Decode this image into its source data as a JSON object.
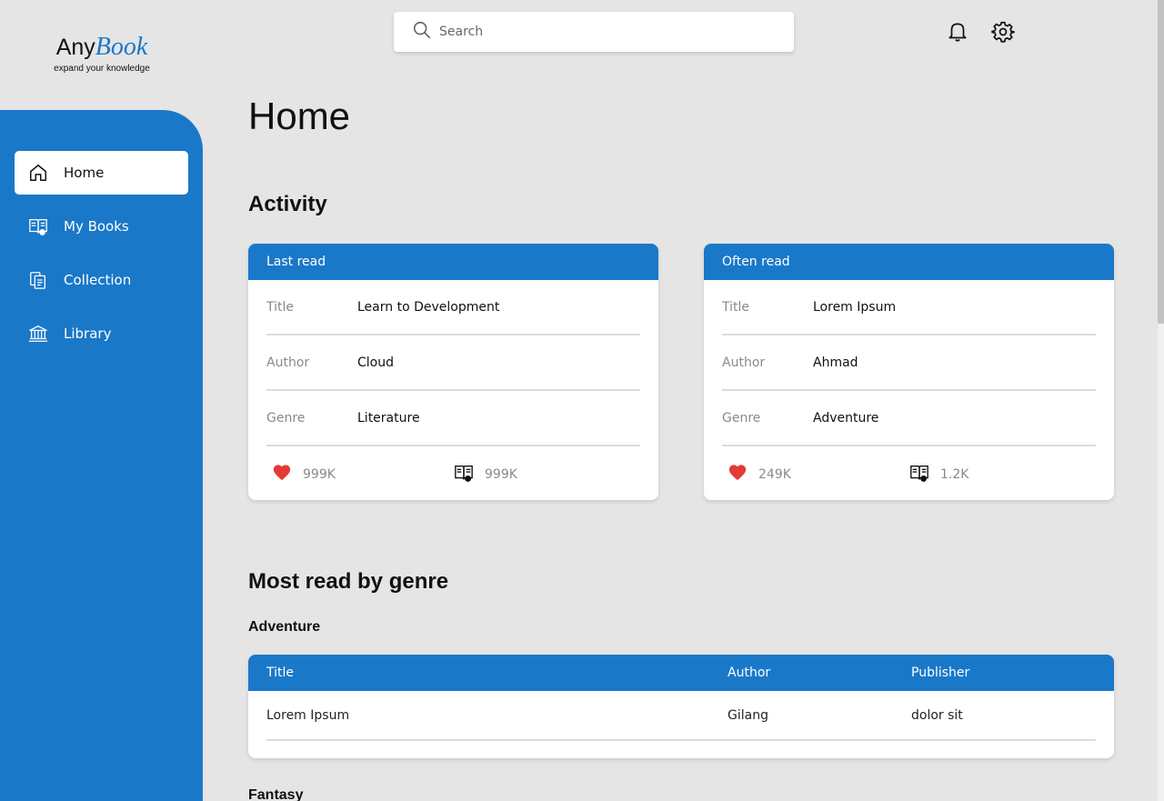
{
  "app": {
    "logo_any": "Any",
    "logo_book": "Book",
    "tagline": "expand your knowledge"
  },
  "colors": {
    "accent": "#1a78c9",
    "background": "#e5e5e5",
    "heart": "#e53935"
  },
  "search": {
    "placeholder": "Search"
  },
  "sidebar": {
    "items": [
      {
        "label": "Home",
        "icon": "home-icon",
        "active": true
      },
      {
        "label": "My Books",
        "icon": "book-reading-icon",
        "active": false
      },
      {
        "label": "Collection",
        "icon": "collection-icon",
        "active": false
      },
      {
        "label": "Library",
        "icon": "library-icon",
        "active": false
      }
    ]
  },
  "header": {
    "title": "Home"
  },
  "activity": {
    "title": "Activity",
    "cards": [
      {
        "heading": "Last read",
        "rows": [
          {
            "label": "Title",
            "value": "Learn to Development"
          },
          {
            "label": "Author",
            "value": "Cloud"
          },
          {
            "label": "Genre",
            "value": "Literature"
          }
        ],
        "likes": "999K",
        "reads": "999K"
      },
      {
        "heading": "Often read",
        "rows": [
          {
            "label": "Title",
            "value": "Lorem Ipsum"
          },
          {
            "label": "Author",
            "value": "Ahmad"
          },
          {
            "label": "Genre",
            "value": "Adventure"
          }
        ],
        "likes": "249K",
        "reads": "1.2K"
      }
    ]
  },
  "genre": {
    "title": "Most read by genre",
    "groups": [
      {
        "name": "Adventure",
        "columns": [
          "Title",
          "Author",
          "Publisher"
        ],
        "rows": [
          [
            "Lorem Ipsum",
            "Gilang",
            "dolor sit"
          ]
        ]
      },
      {
        "name": "Fantasy"
      }
    ]
  }
}
